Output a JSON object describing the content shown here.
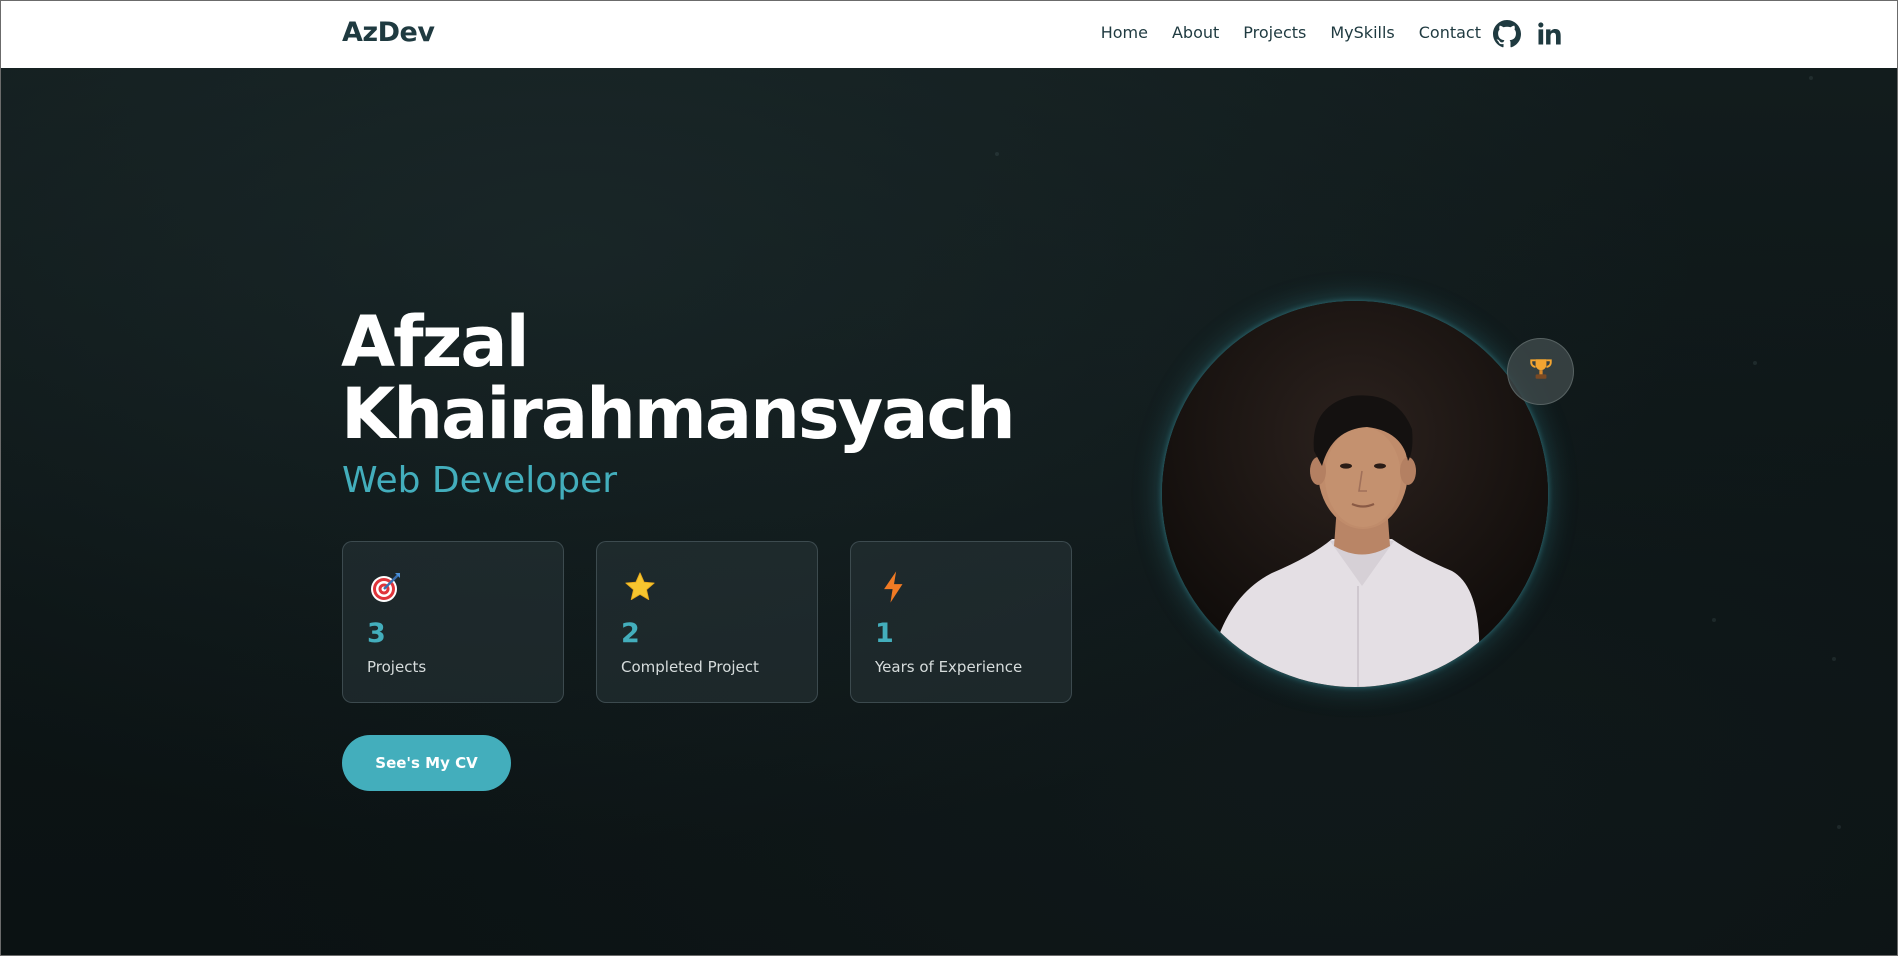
{
  "navbar": {
    "logo": "AzDev",
    "links": [
      "Home",
      "About",
      "Projects",
      "MySkills",
      "Contact"
    ],
    "social_icons": [
      "github-icon",
      "linkedin-icon"
    ]
  },
  "hero": {
    "name_line1": "Afzal",
    "name_line2": "Khairahmansyach",
    "role": "Web Developer",
    "stats": [
      {
        "icon": "target-icon",
        "value": "3",
        "label": "Projects"
      },
      {
        "icon": "star-icon",
        "value": "2",
        "label": "Completed Project"
      },
      {
        "icon": "lightning-icon",
        "value": "1",
        "label": "Years of Experience"
      }
    ],
    "cv_button": "See's My CV",
    "badge_icon": "trophy-icon"
  },
  "colors": {
    "accent": "#43aebc",
    "nav_text": "#1f3a40",
    "background": "#0d1516"
  }
}
